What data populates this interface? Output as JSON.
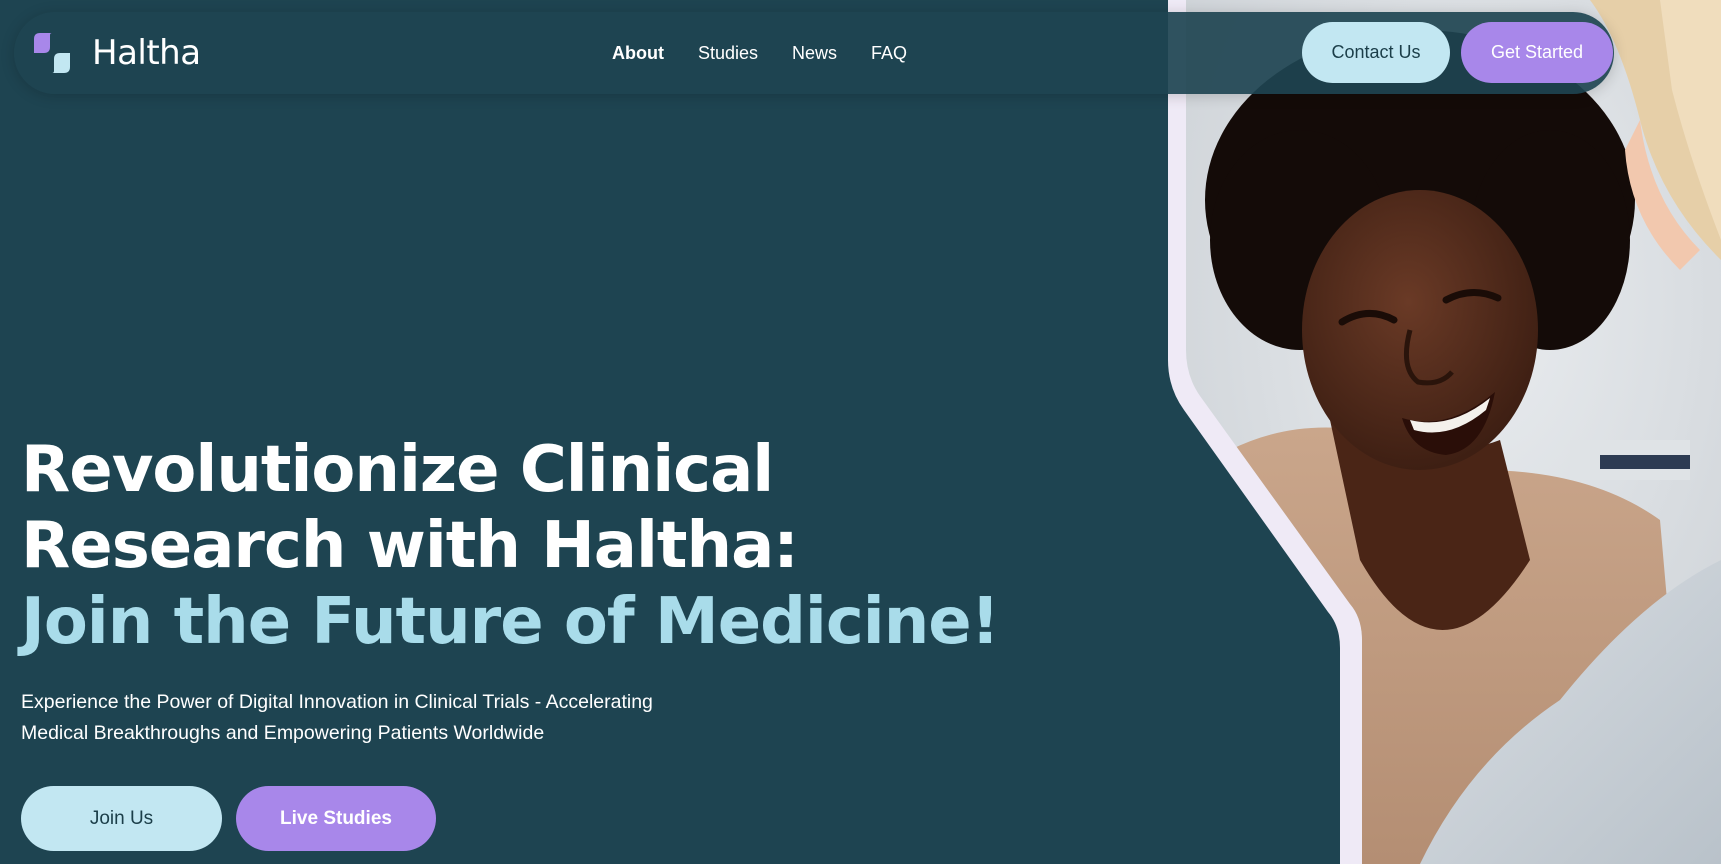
{
  "brand": {
    "name": "Haltha",
    "colors": {
      "background": "#1e4451",
      "accent_light": "#c2e7f2",
      "accent_purple": "#a887ea",
      "headline_accent": "#a9dcea"
    }
  },
  "nav": {
    "links": [
      {
        "label": "About",
        "active": true
      },
      {
        "label": "Studies",
        "active": false
      },
      {
        "label": "News",
        "active": false
      },
      {
        "label": "FAQ",
        "active": false
      }
    ],
    "contact_label": "Contact Us",
    "get_started_label": "Get Started"
  },
  "hero": {
    "title_line1": "Revolutionize Clinical",
    "title_line2": "Research with Haltha:",
    "title_line3": "Join the Future of Medicine!",
    "subtitle_line1": "Experience the Power of Digital Innovation in Clinical Trials - Accelerating",
    "subtitle_line2": "Medical Breakthroughs and Empowering Patients Worldwide",
    "join_label": "Join Us",
    "live_studies_label": "Live Studies"
  },
  "icons": {
    "logo": "haltha-logo-icon",
    "photo": "smiling-patient-photo"
  }
}
